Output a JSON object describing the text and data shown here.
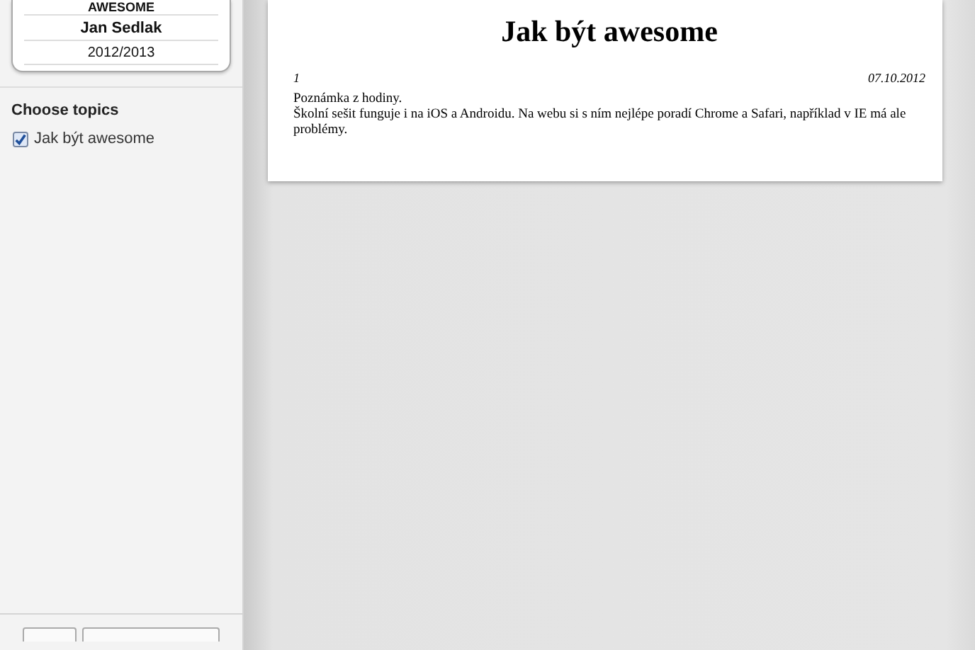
{
  "sidebar": {
    "card": {
      "lines": [
        "AWESOME",
        "Jan Sedlak",
        "2012/2013"
      ]
    },
    "topics_heading": "Choose topics",
    "topics": [
      {
        "label": "Jak být awesome",
        "checked": true
      }
    ]
  },
  "page": {
    "title": "Jak být awesome",
    "number": "1",
    "date": "07.10.2012",
    "paragraphs": [
      "Poznámka z hodiny.",
      "Školní sešit funguje i na iOS a Androidu. Na webu si s ním nejlépe poradí Chrome a Safari, například v IE má ale problémy."
    ]
  }
}
